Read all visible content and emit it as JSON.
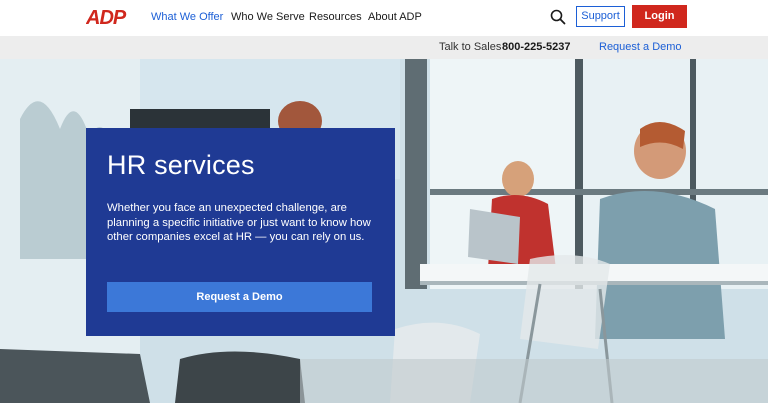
{
  "brand": {
    "logo_text": "ADP",
    "logo_color": "#d0271d"
  },
  "nav": {
    "items": [
      {
        "label": "What We Offer",
        "active": true
      },
      {
        "label": "Who We Serve",
        "active": false
      },
      {
        "label": "Resources",
        "active": false
      },
      {
        "label": "About ADP",
        "active": false
      }
    ],
    "search_icon": "search-icon",
    "support_label": "Support",
    "login_label": "Login"
  },
  "subbar": {
    "talk_label": "Talk to Sales",
    "phone": "800-225-5237",
    "demo_label": "Request a Demo"
  },
  "hero": {
    "title": "HR services",
    "description": "Whether you face an unexpected challenge, are planning a specific initiative or just want to know how other companies excel at HR — you can rely on us.",
    "cta_label": "Request a Demo"
  },
  "colors": {
    "accent_blue": "#1c5fd6",
    "card_navy": "#1f3a94",
    "cta_blue": "#3c78d8",
    "login_red": "#d0271d"
  }
}
